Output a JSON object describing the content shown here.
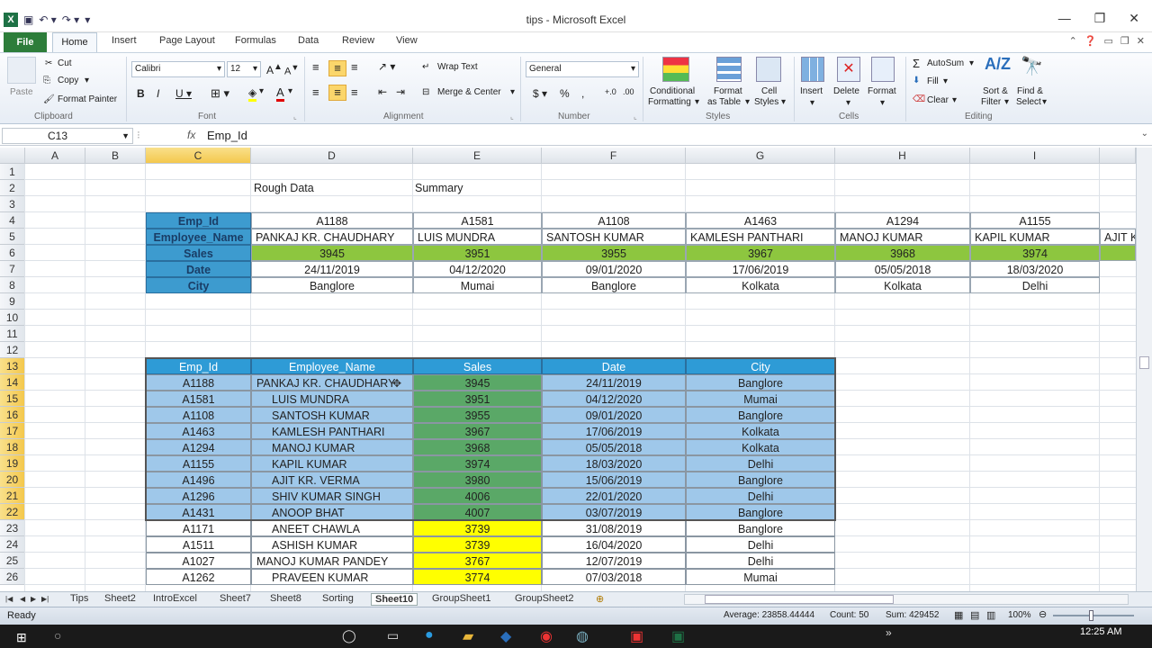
{
  "window": {
    "title": "tips - Microsoft Excel"
  },
  "tabs": [
    "File",
    "Home",
    "Insert",
    "Page Layout",
    "Formulas",
    "Data",
    "Review",
    "View"
  ],
  "ribbon": {
    "clipboard": {
      "label": "Clipboard",
      "paste": "Paste",
      "cut": "Cut",
      "copy": "Copy",
      "format_painter": "Format Painter"
    },
    "font": {
      "label": "Font",
      "name": "Calibri",
      "size": "12"
    },
    "alignment": {
      "label": "Alignment",
      "wrap": "Wrap Text",
      "merge": "Merge & Center"
    },
    "number": {
      "label": "Number",
      "format": "General"
    },
    "styles": {
      "label": "Styles",
      "cond1": "Conditional",
      "cond2": "Formatting",
      "fmt1": "Format",
      "fmt2": "as Table",
      "cell1": "Cell",
      "cell2": "Styles"
    },
    "cells": {
      "label": "Cells",
      "insert": "Insert",
      "delete": "Delete",
      "format": "Format"
    },
    "editing": {
      "label": "Editing",
      "autosum": "AutoSum",
      "fill": "Fill",
      "clear": "Clear",
      "sort1": "Sort &",
      "sort2": "Filter",
      "find1": "Find &",
      "find2": "Select"
    }
  },
  "formula_bar": {
    "name_box": "C13",
    "fx": "fx",
    "value": "Emp_Id"
  },
  "columns": [
    "A",
    "B",
    "C",
    "D",
    "E",
    "F",
    "G",
    "H",
    "I"
  ],
  "rows": [
    "1",
    "2",
    "3",
    "4",
    "5",
    "6",
    "7",
    "8",
    "9",
    "10",
    "11",
    "12",
    "13",
    "14",
    "15",
    "16",
    "17",
    "18",
    "19",
    "20",
    "21",
    "22",
    "23",
    "24",
    "25",
    "26"
  ],
  "labels": {
    "rough": "Rough Data",
    "summary": "Summary"
  },
  "summary_headers": [
    "Emp_Id",
    "Employee_Name",
    "Sales",
    "Date",
    "City"
  ],
  "summary_cols": [
    {
      "id": "A1188",
      "name": "PANKAJ KR. CHAUDHARY",
      "sales": "3945",
      "date": "24/11/2019",
      "city": "Banglore"
    },
    {
      "id": "A1581",
      "name": "LUIS MUNDRA",
      "sales": "3951",
      "date": "04/12/2020",
      "city": "Mumai"
    },
    {
      "id": "A1108",
      "name": "SANTOSH KUMAR",
      "sales": "3955",
      "date": "09/01/2020",
      "city": "Banglore"
    },
    {
      "id": "A1463",
      "name": "KAMLESH PANTHARI",
      "sales": "3967",
      "date": "17/06/2019",
      "city": "Kolkata"
    },
    {
      "id": "A1294",
      "name": "MANOJ KUMAR",
      "sales": "3968",
      "date": "05/05/2018",
      "city": "Kolkata"
    },
    {
      "id": "A1155",
      "name": "KAPIL KUMAR",
      "sales": "3974",
      "date": "18/03/2020",
      "city": "Delhi"
    }
  ],
  "overflow_name": "AJIT K",
  "table_headers": [
    "Emp_Id",
    "Employee_Name",
    "Sales",
    "Date",
    "City"
  ],
  "table_rows": [
    [
      "A1188",
      "PANKAJ KR. CHAUDHARY",
      "3945",
      "24/11/2019",
      "Banglore"
    ],
    [
      "A1581",
      "LUIS MUNDRA",
      "3951",
      "04/12/2020",
      "Mumai"
    ],
    [
      "A1108",
      "SANTOSH KUMAR",
      "3955",
      "09/01/2020",
      "Banglore"
    ],
    [
      "A1463",
      "KAMLESH PANTHARI",
      "3967",
      "17/06/2019",
      "Kolkata"
    ],
    [
      "A1294",
      "MANOJ KUMAR",
      "3968",
      "05/05/2018",
      "Kolkata"
    ],
    [
      "A1155",
      "KAPIL KUMAR",
      "3974",
      "18/03/2020",
      "Delhi"
    ],
    [
      "A1496",
      "AJIT KR. VERMA",
      "3980",
      "15/06/2019",
      "Banglore"
    ],
    [
      "A1296",
      "SHIV KUMAR SINGH",
      "4006",
      "22/01/2020",
      "Delhi"
    ],
    [
      "A1431",
      "ANOOP BHAT",
      "4007",
      "03/07/2019",
      "Banglore"
    ],
    [
      "A1171",
      "ANEET CHAWLA",
      "3739",
      "31/08/2019",
      "Banglore"
    ],
    [
      "A1511",
      "ASHISH KUMAR",
      "3739",
      "16/04/2020",
      "Delhi"
    ],
    [
      "A1027",
      "MANOJ KUMAR PANDEY",
      "3767",
      "12/07/2019",
      "Delhi"
    ],
    [
      "A1262",
      "PRAVEEN KUMAR",
      "3774",
      "07/03/2018",
      "Mumai"
    ]
  ],
  "sheets": [
    "Tips",
    "Sheet2",
    "IntroExcel",
    "Sheet7",
    "Sheet8",
    "Sorting",
    "Sheet10",
    "GroupSheet1",
    "GroupSheet2"
  ],
  "active_sheet": "Sheet10",
  "status": {
    "ready": "Ready",
    "average": "Average: 23858.44444",
    "count": "Count: 50",
    "sum": "Sum: 429452",
    "zoom": "100%",
    "time": "12:25 AM"
  },
  "colors": {
    "header_blue": "#2e9bd6",
    "summary_label_bg": "#3d9bcf",
    "green_row": "#8dc63f",
    "light_blue": "#9fc8ea",
    "sales_green": "#5aa867",
    "yellow": "#ffff00"
  }
}
